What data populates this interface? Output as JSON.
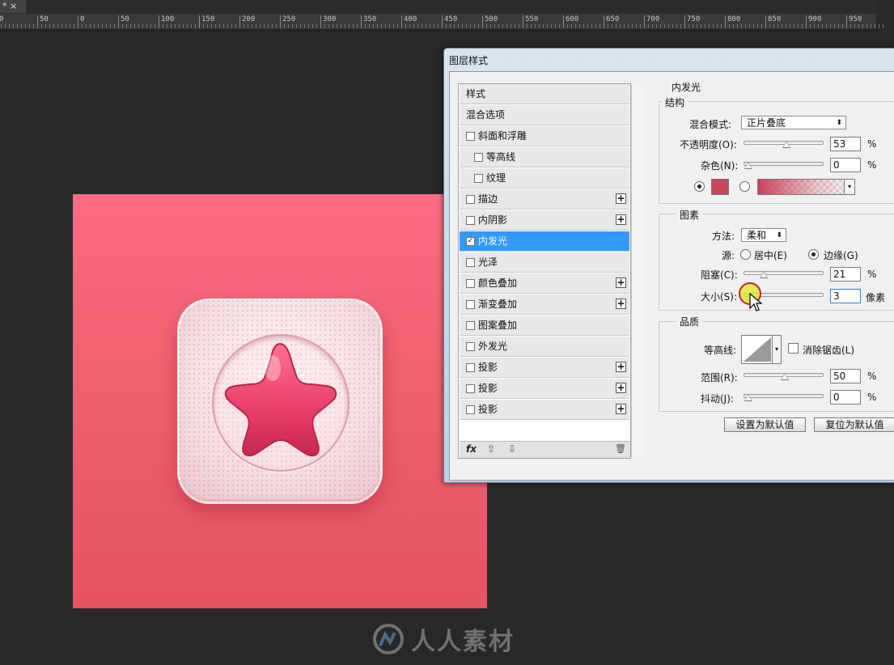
{
  "document_tab": {
    "label": "* ×"
  },
  "ruler": {
    "labels": [
      "0",
      "50",
      "0",
      "50",
      "100",
      "150",
      "200",
      "250",
      "300",
      "350",
      "400",
      "450",
      "500",
      "550",
      "600",
      "650",
      "700",
      "750",
      "800",
      "850",
      "900",
      "950"
    ]
  },
  "watermark": {
    "text": "人人素材"
  },
  "dialog": {
    "title": "图层样式",
    "style_list": {
      "items": [
        {
          "label": "样式",
          "checkbox": false,
          "checked": false,
          "plus": false,
          "indent": 0
        },
        {
          "label": "混合选项",
          "checkbox": false,
          "checked": false,
          "plus": false,
          "indent": 0
        },
        {
          "label": "斜面和浮雕",
          "checkbox": true,
          "checked": false,
          "plus": false,
          "indent": 0
        },
        {
          "label": "等高线",
          "checkbox": true,
          "checked": false,
          "plus": false,
          "indent": 1
        },
        {
          "label": "纹理",
          "checkbox": true,
          "checked": false,
          "plus": false,
          "indent": 1
        },
        {
          "label": "描边",
          "checkbox": true,
          "checked": false,
          "plus": true,
          "indent": 0
        },
        {
          "label": "内阴影",
          "checkbox": true,
          "checked": false,
          "plus": true,
          "indent": 0
        },
        {
          "label": "内发光",
          "checkbox": true,
          "checked": true,
          "plus": false,
          "indent": 0,
          "selected": true
        },
        {
          "label": "光泽",
          "checkbox": true,
          "checked": false,
          "plus": false,
          "indent": 0
        },
        {
          "label": "颜色叠加",
          "checkbox": true,
          "checked": false,
          "plus": true,
          "indent": 0
        },
        {
          "label": "渐变叠加",
          "checkbox": true,
          "checked": false,
          "plus": true,
          "indent": 0
        },
        {
          "label": "图案叠加",
          "checkbox": true,
          "checked": false,
          "plus": false,
          "indent": 0
        },
        {
          "label": "外发光",
          "checkbox": true,
          "checked": false,
          "plus": false,
          "indent": 0
        },
        {
          "label": "投影",
          "checkbox": true,
          "checked": false,
          "plus": true,
          "indent": 0
        },
        {
          "label": "投影",
          "checkbox": true,
          "checked": false,
          "plus": true,
          "indent": 0
        },
        {
          "label": "投影",
          "checkbox": true,
          "checked": false,
          "plus": true,
          "indent": 0
        }
      ],
      "footer": {
        "fx": "fx",
        "up": "⇧",
        "down": "⇩",
        "trash": "🗑"
      }
    },
    "panel": {
      "section_title": "内发光",
      "structure": {
        "title": "结构",
        "blend_mode_label": "混合模式:",
        "blend_mode_value": "正片叠底",
        "opacity_label": "不透明度(O):",
        "opacity_value": "53",
        "opacity_fraction": 0.53,
        "noise_label": "杂色(N):",
        "noise_value": "0",
        "noise_fraction": 0,
        "percent": "%",
        "swatch_color": "#c8445a"
      },
      "elements": {
        "title": "图素",
        "method_label": "方法:",
        "method_value": "柔和",
        "source_label": "源:",
        "source_center": "居中(E)",
        "source_edge": "边缘(G)",
        "choke_label": "阻塞(C):",
        "choke_value": "21",
        "choke_fraction": 0.21,
        "size_label": "大小(S):",
        "size_value": "3",
        "size_unit": "像素",
        "size_fraction": 0.02
      },
      "quality": {
        "title": "品质",
        "contour_label": "等高线:",
        "antialias_label": "消除锯齿(L)",
        "range_label": "范围(R):",
        "range_value": "50",
        "range_fraction": 0.5,
        "jitter_label": "抖动(J):",
        "jitter_value": "0",
        "jitter_fraction": 0
      },
      "buttons": {
        "set_default": "设置为默认值",
        "reset_default": "复位为默认值"
      }
    }
  },
  "colors": {
    "artboard": "#f06675",
    "selection": "#3399ff",
    "accent": "#c8445a"
  }
}
